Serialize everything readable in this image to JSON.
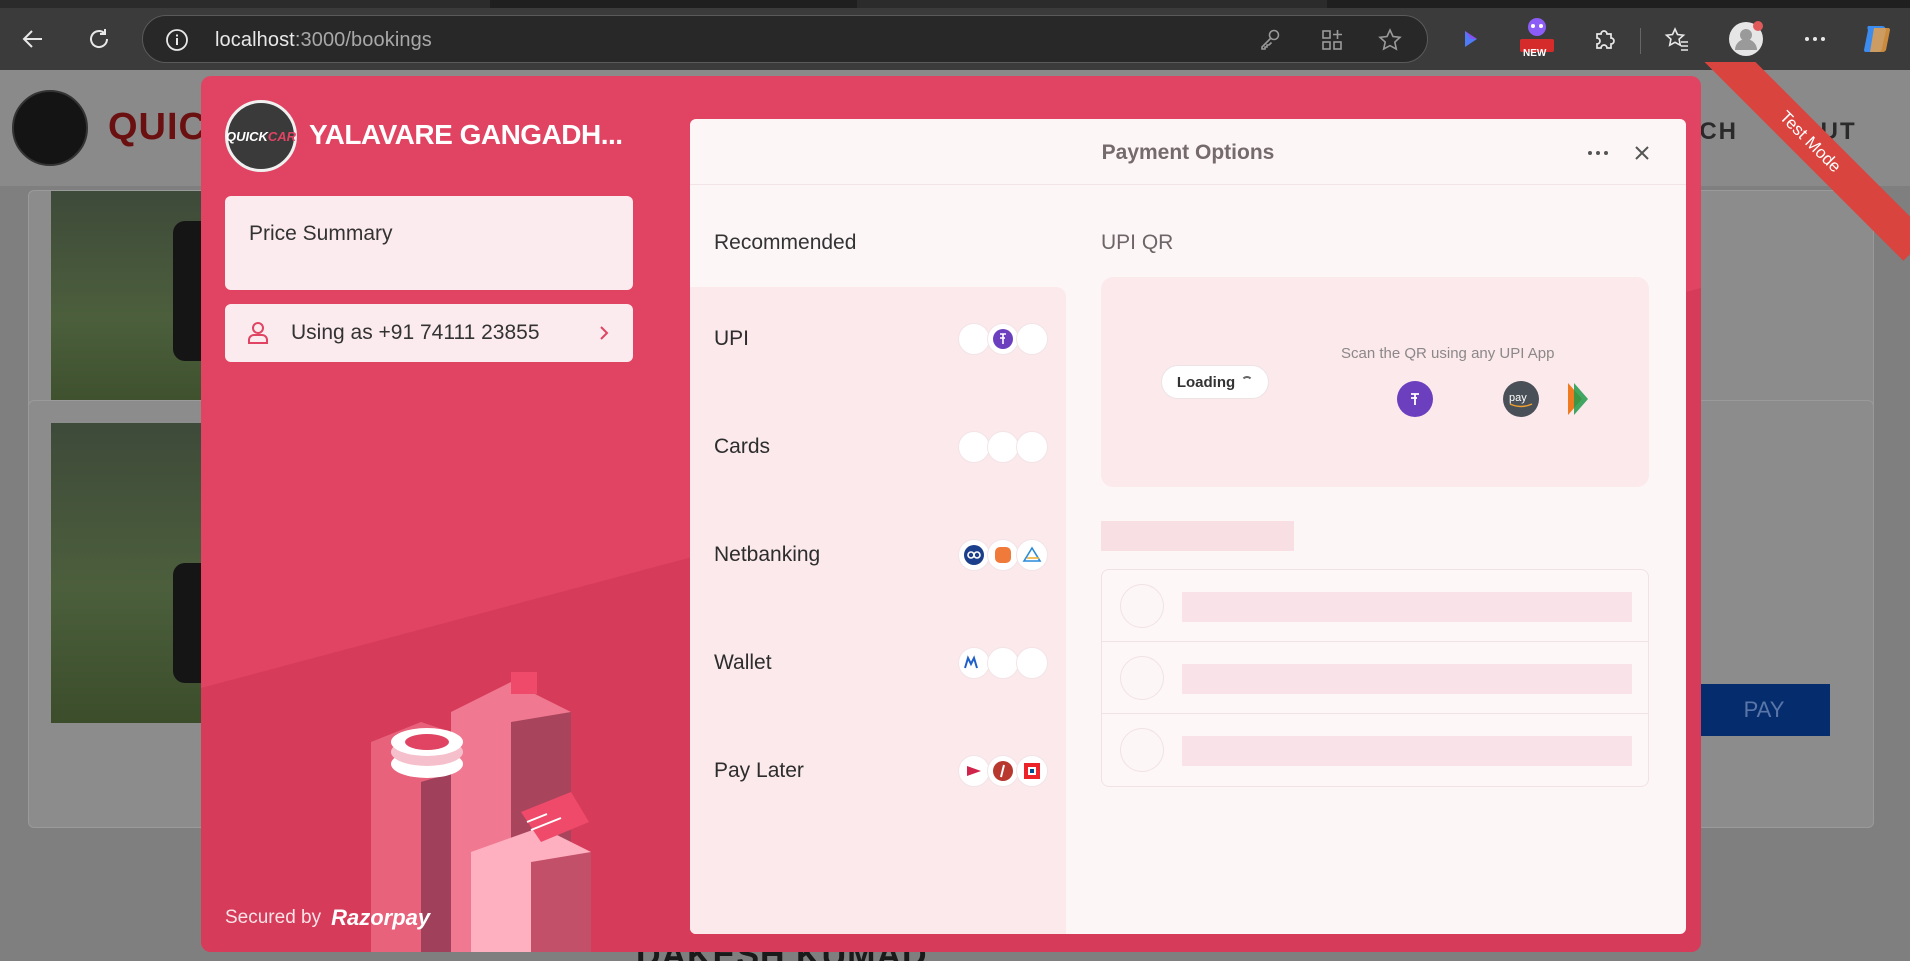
{
  "browser": {
    "url_host": "localhost",
    "url_path": ":3000/bookings",
    "new_badge": "NEW"
  },
  "app": {
    "brand": "QUIC",
    "nav_items": [
      "RCH",
      "OUT"
    ],
    "pay_button": "PAY",
    "bottom_text": "DAKESH KUMAD"
  },
  "checkout": {
    "merchant_logo_text": "QUICK",
    "merchant_logo_accent": "CAR",
    "merchant_name": "YALAVARE GANGADH...",
    "price_summary_label": "Price Summary",
    "user_label": "Using as +91 74111 23855",
    "secured_by": "Secured by",
    "razorpay_brand": "Razorpay",
    "panel_title": "Payment Options",
    "recommended_title": "Recommended",
    "methods": [
      {
        "label": "UPI"
      },
      {
        "label": "Cards"
      },
      {
        "label": "Netbanking"
      },
      {
        "label": "Wallet"
      },
      {
        "label": "Pay Later"
      }
    ],
    "upi_qr_title": "UPI QR",
    "loading_label": "Loading",
    "scan_text": "Scan the QR using any UPI App",
    "test_mode": "Test Mode"
  },
  "colors": {
    "theme": "#e04462",
    "panel_bg": "#fdf6f7",
    "browser_toolbar": "#3b3b3b"
  }
}
